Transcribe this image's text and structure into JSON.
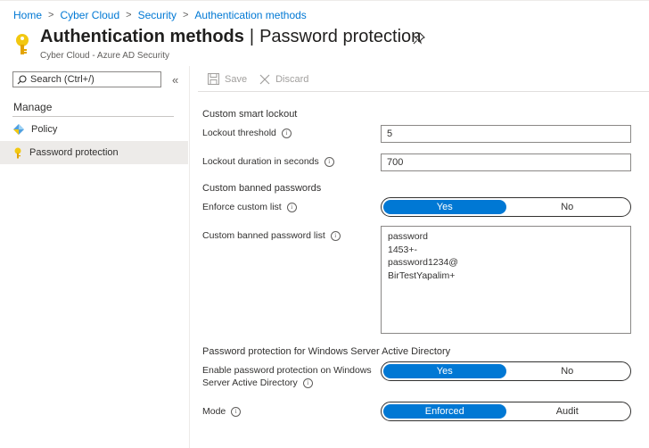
{
  "breadcrumb": [
    "Home",
    "Cyber Cloud",
    "Security",
    "Authentication methods"
  ],
  "header": {
    "title_main": "Authentication methods",
    "title_separator": "|",
    "title_sub": "Password protection",
    "subtitle": "Cyber Cloud - Azure AD Security"
  },
  "sidebar": {
    "search_placeholder": "Search (Ctrl+/)",
    "collapse_glyph": "«",
    "section": "Manage",
    "items": [
      {
        "label": "Policy",
        "icon": "policy-icon",
        "active": false
      },
      {
        "label": "Password protection",
        "icon": "key-icon",
        "active": true
      }
    ]
  },
  "toolbar": {
    "save_label": "Save",
    "discard_label": "Discard"
  },
  "form": {
    "lockout_section": "Custom smart lockout",
    "lockout_threshold_label": "Lockout threshold",
    "lockout_threshold_value": "5",
    "lockout_duration_label": "Lockout duration in seconds",
    "lockout_duration_value": "700",
    "banned_section": "Custom banned passwords",
    "enforce_label": "Enforce custom list",
    "enforce_yes": "Yes",
    "enforce_no": "No",
    "banned_list_label": "Custom banned password list",
    "banned_list": [
      "password",
      "1453+-",
      "password1234@",
      "BirTestYapalim+"
    ],
    "windows_section": "Password protection for Windows Server Active Directory",
    "enable_label_line1": "Enable password protection on Windows",
    "enable_label_line2": "Server Active Directory",
    "enable_yes": "Yes",
    "enable_no": "No",
    "mode_label": "Mode",
    "mode_enforced": "Enforced",
    "mode_audit": "Audit"
  },
  "colors": {
    "accent": "#0078d4",
    "key": "#f2c811"
  }
}
